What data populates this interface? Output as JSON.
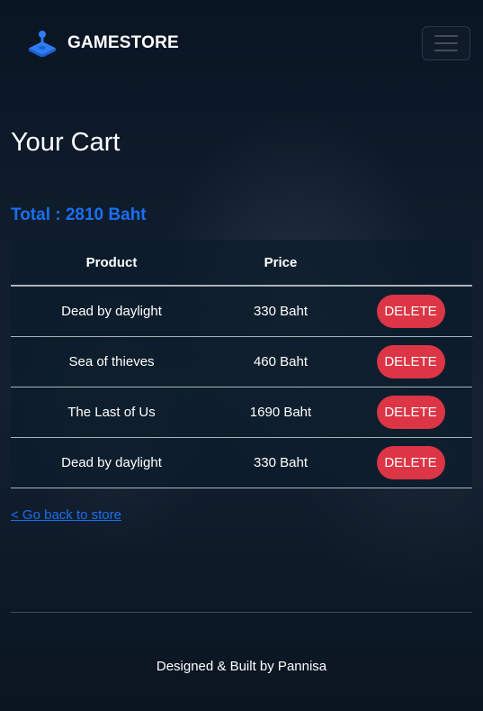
{
  "navbar": {
    "brand_icon": "joystick-icon",
    "brand_name": "GAMESTORE",
    "toggler_icon": "hamburger-menu-icon"
  },
  "cart": {
    "title": "Your Cart",
    "total_label": "Total : 2810 Baht",
    "columns": [
      "Product",
      "Price",
      ""
    ],
    "rows": [
      {
        "product": "Dead by daylight",
        "price": "330 Baht",
        "action": "DELETE"
      },
      {
        "product": "Sea of thieves",
        "price": "460 Baht",
        "action": "DELETE"
      },
      {
        "product": "The Last of Us",
        "price": "1690 Baht",
        "action": "DELETE"
      },
      {
        "product": "Dead by daylight",
        "price": "330 Baht",
        "action": "DELETE"
      }
    ],
    "back_link": "< Go back to store"
  },
  "footer": {
    "text": "Designed & Built by Pannisa"
  },
  "colors": {
    "accent": "#1a6ff2",
    "danger": "#dc3545",
    "background": "#0c1a29"
  }
}
